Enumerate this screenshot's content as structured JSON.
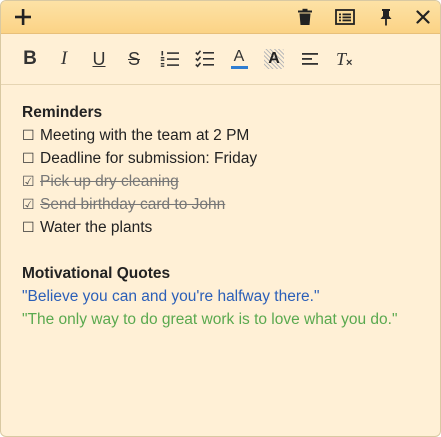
{
  "app": {
    "accent_color": "#fbd386",
    "note_background": "#fff0d6"
  },
  "titlebar": {
    "add_icon": "plus-icon",
    "delete_icon": "trash-icon",
    "notes_list_icon": "list-icon",
    "pin_icon": "pin-icon",
    "close_icon": "close-icon"
  },
  "toolbar": {
    "buttons": [
      {
        "icon": "bold-icon",
        "glyph": "B"
      },
      {
        "icon": "italic-icon",
        "glyph": "I"
      },
      {
        "icon": "underline-icon",
        "glyph": "U"
      },
      {
        "icon": "strikethrough-icon",
        "glyph": "S"
      },
      {
        "icon": "numbered-list-icon"
      },
      {
        "icon": "checklist-icon"
      },
      {
        "icon": "text-color-icon",
        "glyph": "A"
      },
      {
        "icon": "highlight-icon",
        "glyph": "A"
      },
      {
        "icon": "align-icon"
      },
      {
        "icon": "clear-format-icon",
        "glyph": "T"
      }
    ]
  },
  "note": {
    "reminders_heading": "Reminders",
    "reminders": [
      {
        "text": "Meeting with the team at 2 PM",
        "checked": false,
        "box": "☐"
      },
      {
        "text": "Deadline for submission: Friday",
        "checked": false,
        "box": "☐"
      },
      {
        "text": "Pick up dry cleaning",
        "checked": true,
        "box": "☑"
      },
      {
        "text": "Send birthday card to John",
        "checked": true,
        "box": "☑"
      },
      {
        "text": "Water the plants",
        "checked": false,
        "box": "☐"
      }
    ],
    "quotes_heading": "Motivational Quotes",
    "quotes": [
      {
        "text": "\"Believe you can and you're halfway there.\"",
        "color": "#2b5fb8"
      },
      {
        "text": "\"The only way to do great work is to love what you do.\"",
        "color": "#5aa94f"
      }
    ]
  }
}
